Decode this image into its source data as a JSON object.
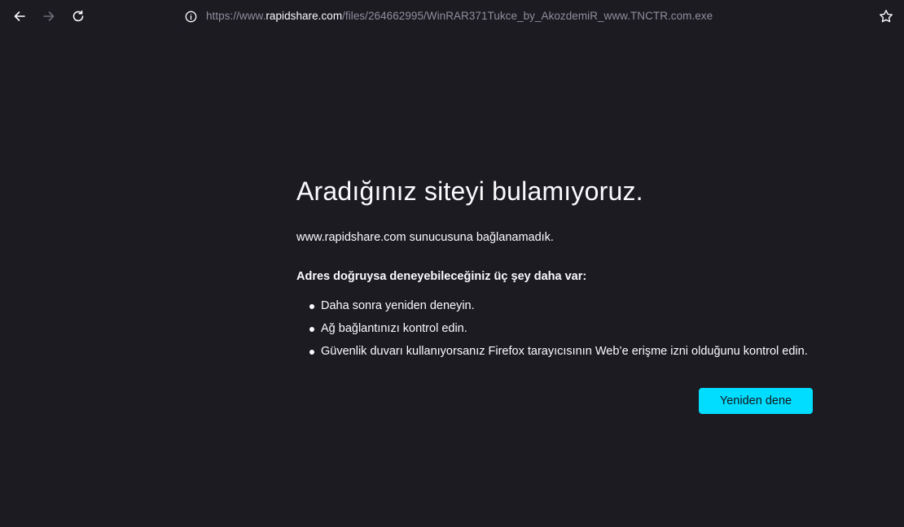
{
  "toolbar": {
    "back_icon": "arrow-left-icon",
    "forward_icon": "arrow-right-icon",
    "reload_icon": "reload-icon",
    "url_prefix": "https://www.",
    "url_domain": "rapidshare.com",
    "url_path": "/files/264662995/WinRAR371Tukce_by_AkozdemiR_www.TNCTR.com.exe",
    "info_icon": "info-icon",
    "bookmark_icon": "star-icon"
  },
  "error": {
    "title": "Aradığınız siteyi bulamıyoruz.",
    "description": "www.rapidshare.com sunucusuna bağlanamadık.",
    "suggestions_heading": "Adres doğruysa deneyebileceğiniz üç şey daha var:",
    "suggestions": [
      "Daha sonra yeniden deneyin.",
      "Ağ bağlantınızı kontrol edin.",
      "Güvenlik duvarı kullanıyorsanız Firefox tarayıcısının Web’e erişme izni olduğunu kontrol edin."
    ],
    "retry_label": "Yeniden dene"
  },
  "colors": {
    "background": "#1c1b22",
    "text": "#fbfbfe",
    "muted": "#8f8f9d",
    "accent": "#00ddff"
  }
}
